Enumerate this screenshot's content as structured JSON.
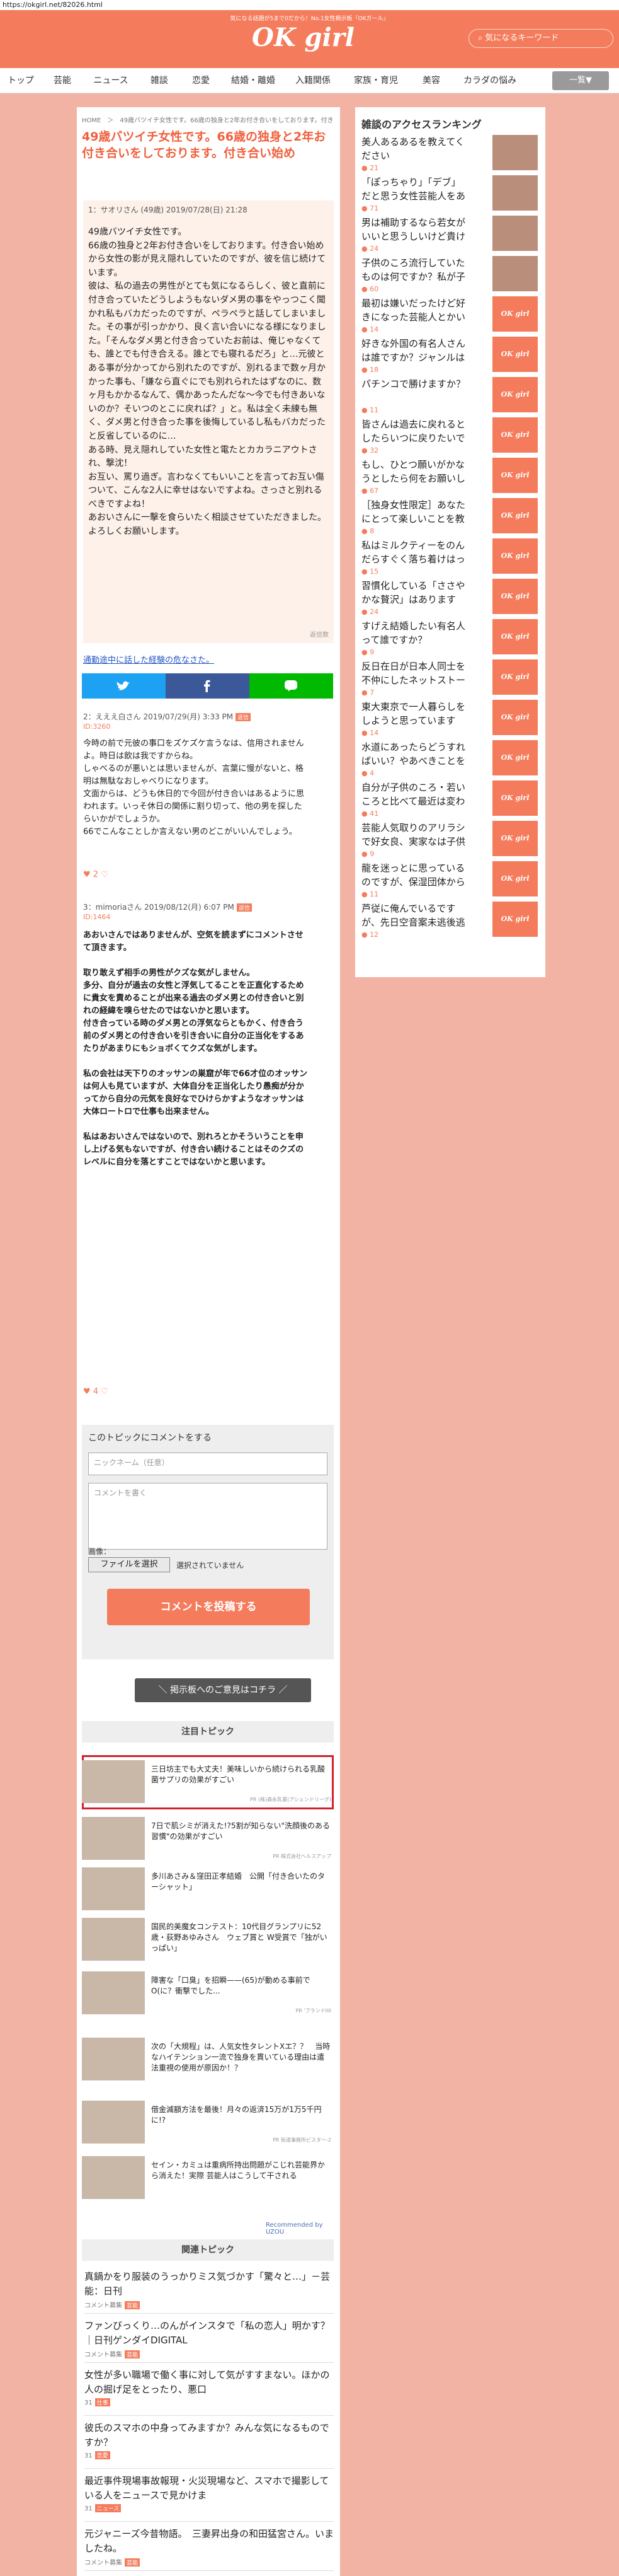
{
  "browser": {
    "url": "https://okgirl.net/82026.html"
  },
  "site": {
    "tagline": "気になる話題が5まで0だから！No.1女性掲示板『OKガール』",
    "logo": "OK girl",
    "search_placeholder": "気になるキーワード"
  },
  "nav": {
    "items": [
      "トップ",
      "芸能",
      "ニュース",
      "雑談",
      "恋愛",
      "結婚・離婚",
      "入籍関係",
      "家族・育児",
      "美容",
      "カラダの悩み"
    ],
    "more": "一覧▼"
  },
  "breadcrumb": "HOME　＞　49歳バツイチ女性です。66歳の独身と2年お付き合いをしております。付き合い始め",
  "topic": {
    "title": "49歳バツイチ女性です。66歳の独身と2年お付き合いをしております。付き合い始め",
    "post_meta": "1：サオリさん (49歳) 2019/07/28(日) 21:28",
    "post_body": "49歳バツイチ女性です。\n66歳の独身と2年お付き合いをしております。付き合い始めから女性の影が見え隠れしていたのですが、彼を信じ続けています。\n彼は、私の過去の男性がとても気になるらしく、彼と直前に付き合っていたどうしようもないダメ男の事をやっつこく聞かれ私もバカだったのですが、ペラペラと話してしまいました。その事が引っかかり、良く言い合いになる様になりました。「そんなダメ男と付き合っていたお前は、俺じゃなくても、誰とでも付き合える。誰とでも寝れるだろ」と…元彼とある事が分かってから別れたのですが、別れるまで数ヶ月かかった事も、「嫌なら直ぐにでも別れられたはずなのに、数ヶ月もかかるなんて、偶かあったんだな〜今でも付きあいないのか？そいつのとこに戻れば？」と。私は全く未練も無く、ダメ男と付き合った事を後悔しているし私もバカだったと反省しているのに…\nある時、見え隠れしていた女性と電たとカカラニアウトされ、撃沈！\nお互い、罵り過ぎ。言わなくてもいいことを言ってお互い傷ついて、こんな2人に幸せはないですよね。さっさと別れるべきですよね！\nあおいさんに一擊を食らいたく相談させていただきました。\nよろしくお願いします。",
    "reply_label": "返信数",
    "related_link": "通勤途中に話した経験の危なさた。"
  },
  "share": {
    "twitter": "twitter-share",
    "facebook": "facebook-share",
    "line": "line-share"
  },
  "comments": [
    {
      "meta": "2：えええ白さん 2019/07/29(月) 3:33 PM",
      "id": "ID:3260",
      "badge": "返信",
      "body": "今時の前で元彼の事口をズケズケ言うなは、信用されませんよ。時日は飲は我ですからね。\nしゃべるのが悪いとは思いませんが、言葉に慢がないと、格明は無駄なおしゃべりになります。\n文面からは、どうも休日的で今回が付き合いはあるように思われます。いっそ休日の関係に割り切って、他の男を探したらいかがでしょうか。\n66でこんなことしか言えない男のどこがいいんでしょう。",
      "likes": "2"
    },
    {
      "meta": "3：mimoriaさん 2019/08/12(月) 6:07 PM",
      "id": "ID:1464",
      "badge": "返信",
      "body": "あおいさんではありませんが、空気を読まずにコメントさせて頂きます。\n\n取り敢えず相手の男性がクズな気がしません。\n多分、自分が過去の女性と浮気してることを正直化するために貴女を責めることが出来る過去のダメ男との付き合いと別れの経緯を嗅らせたのではないかと思います。\n付き合っている時のダメ男との浮気ならともかく、付き合う前のダメ男との付き合いを引き合いに自分の正当化をするあたりがあまりにもショボくてクズな気がします。\n\n私の会社は天下りのオッサンの巣窟が年で66才位のオッサンは何人も見ていますが、大体自分を正当化したり愚痴が分かってから自分の元気を良好なでひけらかすようなオッサンは大体ロートロで仕事も出来ません。\n\n私はあおいさんではないので、別れろとかそういうことを申し上げる気もないですが、付き合い続けることはそのクズのレベルに自分を落とすことではないかと思います。",
      "likes": "4"
    }
  ],
  "comment_form": {
    "title": "このトピックにコメントをする",
    "name_placeholder": "ニックネーム（任意）",
    "body_placeholder": "コメントを書く",
    "image_label": "画像：",
    "file_button": "ファイルを選択",
    "file_status": "選択されていません",
    "submit": "コメントを投稿する"
  },
  "board_button": "＼ 掲示板へのご意見はコチラ ／",
  "featured": {
    "heading": "注目トピック",
    "items": [
      {
        "text": "三日坊主でも大丈夫！美味しいから続けられる乳酸菌サプリの効果がすごい",
        "src": "PR (株)森永乳業(アシェンドリーグ)"
      },
      {
        "text": "7日で肌シミが消えた!?5割が知らない\"洗顔後のある習慣\"の効果がすごい",
        "src": "PR 株式会社ヘルスアップ"
      },
      {
        "text": "多川あさみ＆窪田正孝結婚　公開「付き合いたのターシャット」",
        "src": ""
      },
      {
        "text": "国民的美魔女コンテスト：10代目グランプリに52歳・荻野あゆみさん　ウェブ賞と W受賞で「独がいっぱい」",
        "src": ""
      },
      {
        "text": "障害な「口臭」を招瞬——(65)が動める事前でO(に？衝撃でした...",
        "src": "PR 'ブランドIIII"
      },
      {
        "text": "次の「大規程」は、人気女性タレントXエ？？　当時なハイテンション一流で独身を貫いている理由は遣法重視の使用が原因か！？",
        "src": ""
      },
      {
        "text": "借金減額方法を最後！月々の返済15万が1万5千円に!?",
        "src": "PR 街道事務所ピスター-2"
      },
      {
        "text": "セイン・カミュは重病所持出問題がこじれ芸能界から消えた！実際 芸能人はこうして干される",
        "src": ""
      }
    ],
    "recommended": "Recommended by UZOU"
  },
  "related": {
    "heading": "関連トピック",
    "items": [
      {
        "title": "真鍋かをり服装のうっかりミス気づかす「驚々と…」－芸能：日刊",
        "meta": "コメント募集",
        "badge": "芸能"
      },
      {
        "title": "ファンびっくり…のんがインスタで「私の恋人」明かす？｜日刊ゲンダイDIGITAL",
        "meta": "コメント募集",
        "badge": "芸能"
      },
      {
        "title": "女性が多い職場で働く事に対して気がすすまない。ほかの人の掘げ足をとったり、悪口",
        "meta": "31",
        "badge": "仕事"
      },
      {
        "title": "彼氏のスマホの中身ってみますか？みんな気になるものですか？",
        "meta": "31",
        "badge": "恋愛"
      },
      {
        "title": "最近事件現場事故報現・火災現場など、スマホで撮影している人をニュースで見かけま",
        "meta": "31",
        "badge": "ニュース"
      },
      {
        "title": "元ジャニーズ今昔物語。　三妻昇出身の和田猛宮さん。いましたね。",
        "meta": "コメント募集",
        "badge": "芸能"
      }
    ]
  },
  "ranking": {
    "heading": "雑談のアクセスランキング",
    "items": [
      {
        "text": "美人あるあるを教えてください",
        "count": "21",
        "thumb": "photo"
      },
      {
        "text": "「ぽっちゃり」「デブ」だと思う女性芸能人をあげて、その最判定を教えるトピ",
        "count": "71",
        "thumb": "photo"
      },
      {
        "text": "男は補助するなら若女がいいと思うしいけど貴けば独身の主婦高合わないに男は淡にある程ある年子供の産めないダメ女でもいいのかな!?",
        "count": "24",
        "thumb": "photo"
      },
      {
        "text": "子供のころ流行していたものは何ですか？私が子供のころはキンけが流行っていた気がします",
        "count": "60",
        "thumb": "photo"
      },
      {
        "text": "最初は嫌いだったけど好きになった芸能人とかいますか？",
        "count": "14",
        "thumb": "logo"
      },
      {
        "text": "好きな外国の有名人さんは誰ですか？ジャンルは問いません",
        "count": "18",
        "thumb": "logo"
      },
      {
        "text": "パチンコで勝けますか？",
        "count": "11",
        "thumb": "logo"
      },
      {
        "text": "皆さんは過去に戻れるとしたらいつに戻りたいですか？",
        "count": "32",
        "thumb": "logo"
      },
      {
        "text": "もし、ひとつ願いがかなうとしたら何をお願いしたいですか？",
        "count": "67",
        "thumb": "logo"
      },
      {
        "text": "［独身女性限定］あなたにとって楽しいことを教えて下さい！",
        "count": "8",
        "thumb": "logo"
      },
      {
        "text": "私はミルクティーをのんだらすぐく落ち着けはっとしますなさんは何をしたときに落ち着きますか？",
        "count": "15",
        "thumb": "logo"
      },
      {
        "text": "習慣化している「ささやかな贅沢」はありますか？",
        "count": "24",
        "thumb": "logo"
      },
      {
        "text": "すげえ結婚したい有名人って誰ですか？",
        "count": "9",
        "thumb": "logo"
      },
      {
        "text": "反日在日が日本人同士を不仲にしたネットストーカーして日本人をイジメる現実。",
        "count": "7",
        "thumb": "logo"
      },
      {
        "text": "東大東京で一人暮らしをしようと思っています",
        "count": "14",
        "thumb": "logo"
      },
      {
        "text": "水道にあったらどうすればいい？やあべきことをまとめました",
        "count": "4",
        "thumb": "logo"
      },
      {
        "text": "自分が子供のころ・若いころと比べて最近は変わったなと思うことってありますか？振静をしたり則っていそうな子に声をか…",
        "count": "41",
        "thumb": "logo"
      },
      {
        "text": "芸能人気取りのアリラシで好女良、実家なは子供をマスコミ公開して、子供が可視そう。",
        "count": "9",
        "thumb": "logo"
      },
      {
        "text": "龍を迷っとに思っているのですが、保湿団体から同うことが嫌いです。プライバシーにズカズカ踏み込まれるようじゃないで…",
        "count": "11",
        "thumb": "logo"
      },
      {
        "text": "芦従に俺んでいるですが、先日空音案未逃後逃にありました。たまた麦近所の人からも音が聞こえたり電話をりけ声をかけら退けて行っ…",
        "count": "12",
        "thumb": "logo"
      }
    ]
  },
  "colors": {
    "brand": "#f47c5c",
    "bg": "#f3b3a4",
    "title": "#f0603d",
    "link": "#2356c5"
  }
}
